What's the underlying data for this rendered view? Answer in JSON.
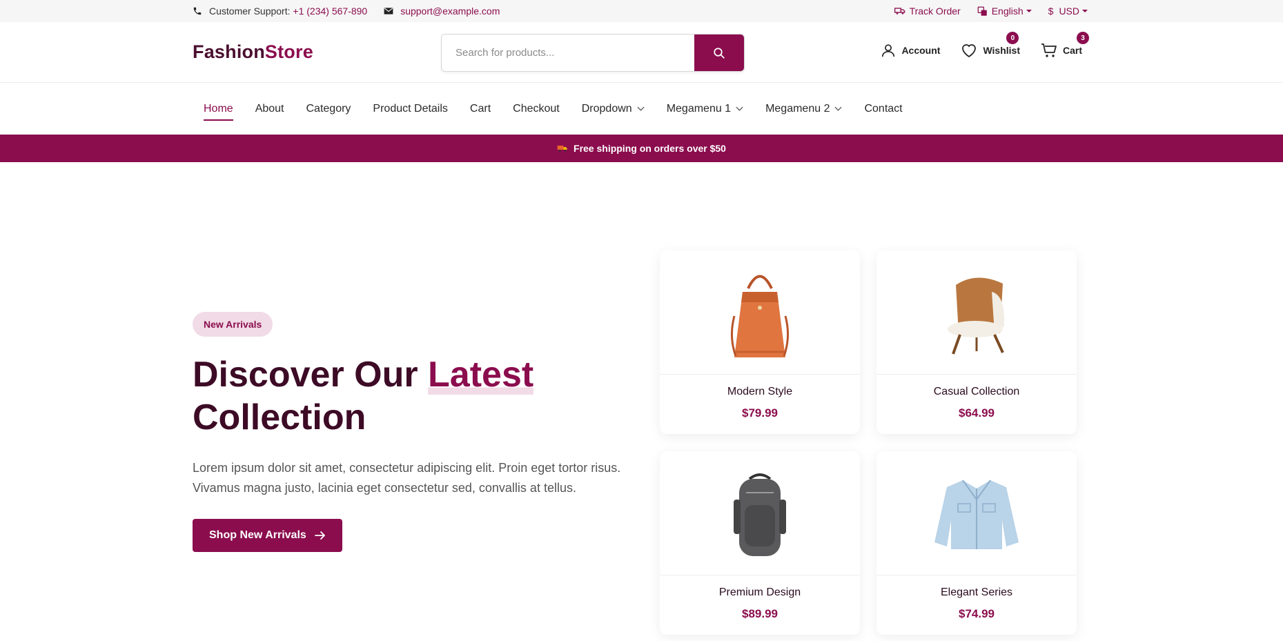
{
  "topbar": {
    "support_label": "Customer Support:",
    "support_phone": "+1 (234) 567-890",
    "email": "support@example.com",
    "track_order": "Track Order",
    "language": "English",
    "currency_symbol": "$",
    "currency": "USD"
  },
  "header": {
    "logo_part1": "Fashion",
    "logo_part2": "Store",
    "search_placeholder": "Search for products...",
    "account_label": "Account",
    "wishlist_label": "Wishlist",
    "wishlist_count": "0",
    "cart_label": "Cart",
    "cart_count": "3"
  },
  "nav": {
    "items": [
      {
        "label": "Home"
      },
      {
        "label": "About"
      },
      {
        "label": "Category"
      },
      {
        "label": "Product Details"
      },
      {
        "label": "Cart"
      },
      {
        "label": "Checkout"
      },
      {
        "label": "Dropdown"
      },
      {
        "label": "Megamenu 1"
      },
      {
        "label": "Megamenu 2"
      },
      {
        "label": "Contact"
      }
    ]
  },
  "promo": {
    "text": "Free shipping on orders over $50"
  },
  "hero": {
    "badge": "New Arrivals",
    "title_part1": "Discover Our ",
    "title_highlight": "Latest",
    "title_part2": "Collection",
    "description": "Lorem ipsum dolor sit amet, consectetur adipiscing elit. Proin eget tortor risus. Vivamus magna justo, lacinia eget consectetur sed, convallis at tellus.",
    "cta_label": "Shop New Arrivals"
  },
  "products": [
    {
      "name": "Modern Style",
      "price": "$79.99",
      "icon": "handbag-image"
    },
    {
      "name": "Casual Collection",
      "price": "$64.99",
      "icon": "armchair-image"
    },
    {
      "name": "Premium Design",
      "price": "$89.99",
      "icon": "backpack-image"
    },
    {
      "name": "Elegant Series",
      "price": "$74.99",
      "icon": "denim-jacket-image"
    }
  ],
  "colors": {
    "accent": "#8b0d4e",
    "heading": "#3d0b26",
    "pill_bg": "#f1dbe6"
  }
}
